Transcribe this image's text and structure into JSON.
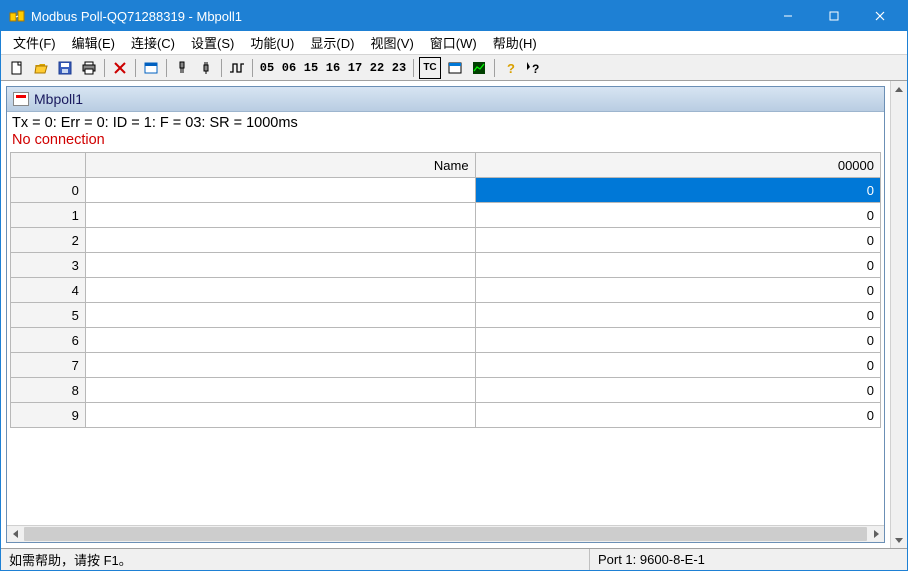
{
  "titlebar": {
    "title": "Modbus Poll-QQ71288319 - Mbpoll1"
  },
  "menu": {
    "items": [
      "文件(F)",
      "编辑(E)",
      "连接(C)",
      "设置(S)",
      "功能(U)",
      "显示(D)",
      "视图(V)",
      "窗口(W)",
      "帮助(H)"
    ]
  },
  "toolbar": {
    "codes": [
      "05",
      "06",
      "15",
      "16",
      "17",
      "22",
      "23"
    ],
    "tc_label": "TC"
  },
  "child": {
    "title": "Mbpoll1",
    "status_line": "Tx = 0: Err = 0: ID = 1: F = 03: SR = 1000ms",
    "error_line": "No connection",
    "columns": {
      "name": "Name",
      "value": "00000"
    },
    "rows": [
      {
        "idx": "0",
        "name": "",
        "val": "0",
        "selected": true
      },
      {
        "idx": "1",
        "name": "",
        "val": "0",
        "selected": false
      },
      {
        "idx": "2",
        "name": "",
        "val": "0",
        "selected": false
      },
      {
        "idx": "3",
        "name": "",
        "val": "0",
        "selected": false
      },
      {
        "idx": "4",
        "name": "",
        "val": "0",
        "selected": false
      },
      {
        "idx": "5",
        "name": "",
        "val": "0",
        "selected": false
      },
      {
        "idx": "6",
        "name": "",
        "val": "0",
        "selected": false
      },
      {
        "idx": "7",
        "name": "",
        "val": "0",
        "selected": false
      },
      {
        "idx": "8",
        "name": "",
        "val": "0",
        "selected": false
      },
      {
        "idx": "9",
        "name": "",
        "val": "0",
        "selected": false
      }
    ]
  },
  "statusbar": {
    "help": "如需帮助，请按 F1。",
    "port": "Port 1: 9600-8-E-1"
  }
}
